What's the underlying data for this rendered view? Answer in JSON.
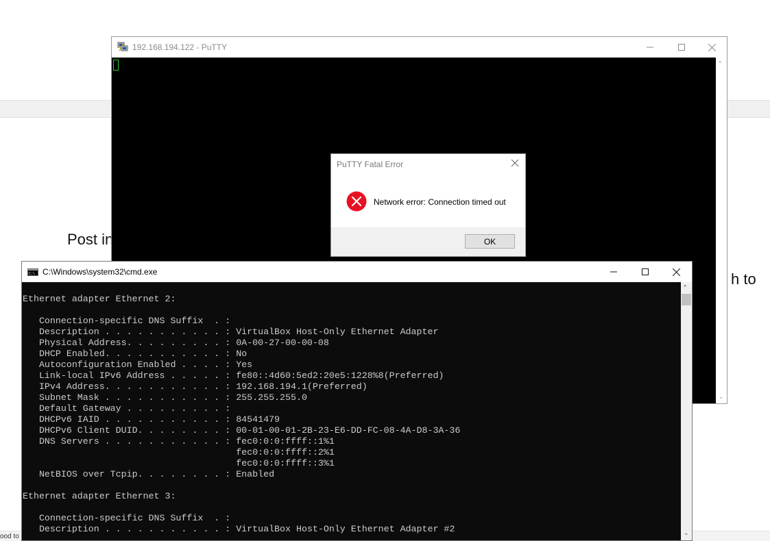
{
  "background": {
    "text_post": "Post in",
    "text_to": "h to",
    "footer_text": "ood to"
  },
  "putty": {
    "title": "192.168.194.122 - PuTTY",
    "icon": "putty-icon",
    "cursor_color": "#1fd11f"
  },
  "dialog": {
    "title": "PuTTY Fatal Error",
    "icon": "error-icon",
    "message": "Network error: Connection timed out",
    "ok_label": "OK",
    "error_color": "#e81123"
  },
  "cmd": {
    "title": "C:\\Windows\\system32\\cmd.exe",
    "icon": "console-icon",
    "lines": [
      "Ethernet adapter Ethernet 2:",
      "",
      "   Connection-specific DNS Suffix  . :",
      "   Description . . . . . . . . . . . : VirtualBox Host-Only Ethernet Adapter",
      "   Physical Address. . . . . . . . . : 0A-00-27-00-00-08",
      "   DHCP Enabled. . . . . . . . . . . : No",
      "   Autoconfiguration Enabled . . . . : Yes",
      "   Link-local IPv6 Address . . . . . : fe80::4d60:5ed2:20e5:1228%8(Preferred)",
      "   IPv4 Address. . . . . . . . . . . : 192.168.194.1(Preferred)",
      "   Subnet Mask . . . . . . . . . . . : 255.255.255.0",
      "   Default Gateway . . . . . . . . . :",
      "   DHCPv6 IAID . . . . . . . . . . . : 84541479",
      "   DHCPv6 Client DUID. . . . . . . . : 00-01-00-01-2B-23-E6-DD-FC-08-4A-D8-3A-36",
      "   DNS Servers . . . . . . . . . . . : fec0:0:0:ffff::1%1",
      "                                       fec0:0:0:ffff::2%1",
      "                                       fec0:0:0:ffff::3%1",
      "   NetBIOS over Tcpip. . . . . . . . : Enabled",
      "",
      "Ethernet adapter Ethernet 3:",
      "",
      "   Connection-specific DNS Suffix  . :",
      "   Description . . . . . . . . . . . : VirtualBox Host-Only Ethernet Adapter #2"
    ]
  },
  "colors": {
    "terminal_bg": "#0c0c0c",
    "terminal_fg": "#cccccc"
  }
}
